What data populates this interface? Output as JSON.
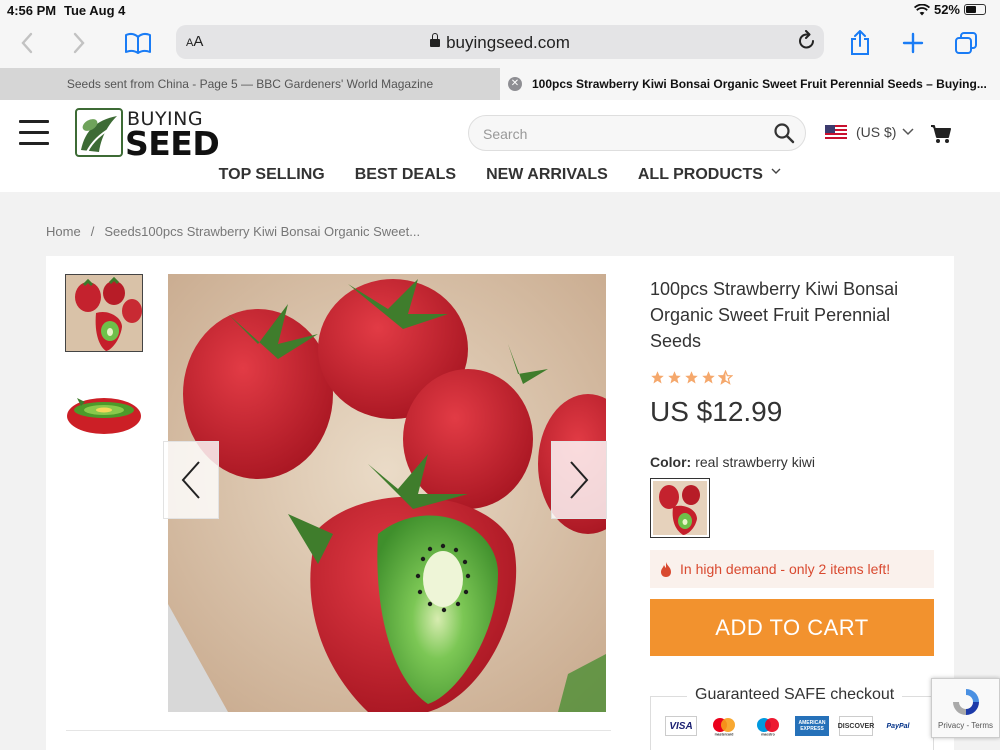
{
  "status_bar": {
    "time": "4:56 PM",
    "date": "Tue Aug 4",
    "battery": "52%"
  },
  "browser": {
    "text_size_label": "AA",
    "url": "buyingseed.com",
    "tabs": [
      {
        "title": "Seeds sent from China - Page 5 — BBC Gardeners' World Magazine",
        "active": false
      },
      {
        "title": "100pcs Strawberry Kiwi Bonsai Organic Sweet Fruit Perennial Seeds – Buying...",
        "active": true
      }
    ]
  },
  "site": {
    "logo_line1": "BUYING",
    "logo_line2": "SEED",
    "search_placeholder": "Search",
    "currency": "(US $)",
    "nav": [
      "TOP SELLING",
      "BEST DEALS",
      "NEW ARRIVALS",
      "ALL PRODUCTS"
    ]
  },
  "breadcrumb": {
    "home": "Home",
    "current": "Seeds100pcs Strawberry Kiwi Bonsai Organic Sweet..."
  },
  "product": {
    "title": "100pcs Strawberry Kiwi Bonsai Organic Sweet Fruit Perennial Seeds",
    "rating": 4.5,
    "price": "US $12.99",
    "color_label": "Color:",
    "color_value": "real strawberry kiwi",
    "demand_text": "In high demand - only 2 items left!",
    "add_to_cart": "ADD TO CART",
    "safe_checkout": "Guaranteed SAFE checkout",
    "payment_methods": [
      "VISA",
      "mastercard",
      "maestro",
      "AMERICAN EXPRESS",
      "DISCOVER",
      "PayPal"
    ]
  },
  "recaptcha": {
    "text": "Privacy - Terms"
  },
  "colors": {
    "accent": "#f2922e",
    "demand_red": "#d94a30",
    "safari_blue": "#1a7cf5",
    "logo_green": "#3d6b35"
  }
}
